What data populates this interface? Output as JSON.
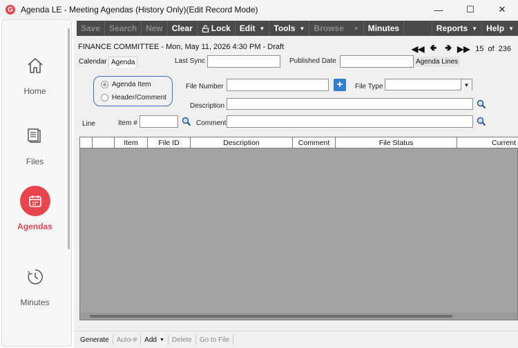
{
  "window": {
    "title": "Agenda LE - Meeting Agendas (History Only)(Edit Record Mode)",
    "logo_letter": "G",
    "accent": "#e8454e"
  },
  "sidebar": {
    "items": [
      {
        "label": "Home",
        "icon": "home-icon"
      },
      {
        "label": "Files",
        "icon": "files-icon"
      },
      {
        "label": "Agendas",
        "icon": "calendar-icon",
        "active": true
      },
      {
        "label": "Minutes",
        "icon": "clock-icon"
      }
    ]
  },
  "toolbar": {
    "save": "Save",
    "search": "Search",
    "new": "New",
    "clear": "Clear",
    "lock": "Lock",
    "edit": "Edit",
    "tools": "Tools",
    "browse": "Browse",
    "minutes": "Minutes",
    "reports": "Reports",
    "help": "Help"
  },
  "record": {
    "title": "FINANCE COMMITTEE - Mon, May 11, 2026 4:30 PM - Draft",
    "position": "15",
    "of_label": "of",
    "total": "236"
  },
  "tabs": {
    "calendar": "Calendar",
    "agenda": "Agenda",
    "agenda_lines": "Agenda Lines"
  },
  "form": {
    "last_sync_label": "Last Sync",
    "last_sync_value": "",
    "published_date_label": "Published Date",
    "published_date_value": "",
    "radio_agenda_item": "Agenda Item",
    "radio_header_comment": "Header/Comment",
    "file_number_label": "File Number",
    "file_number_value": "",
    "file_type_label": "File Type",
    "file_type_value": "",
    "description_label": "Description",
    "description_value": "",
    "line_label": "Line",
    "item_num_label": "Item #",
    "item_num_value": "",
    "comment_label": "Comment",
    "comment_value": ""
  },
  "grid": {
    "columns": [
      "",
      "",
      "Item",
      "File ID",
      "Description",
      "Comment",
      "File Status",
      "Current"
    ],
    "rows": []
  },
  "bottom": {
    "generate": "Generate",
    "auto": "Auto-#",
    "add": "Add",
    "delete": "Delete",
    "goto": "Go to File"
  }
}
